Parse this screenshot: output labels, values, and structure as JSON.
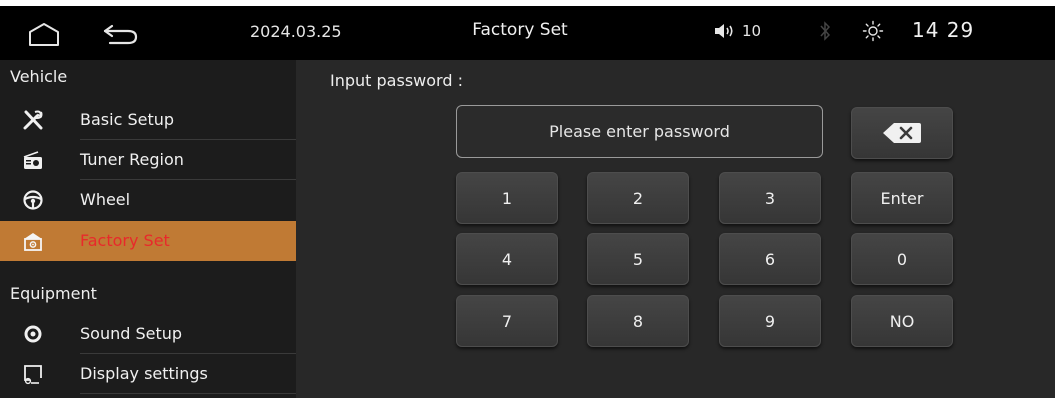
{
  "status_bar": {
    "date": "2024.03.25",
    "title": "Factory Set",
    "volume": "10",
    "time": "14 29"
  },
  "sidebar": {
    "sections": [
      {
        "heading": "Vehicle",
        "items": [
          {
            "label": "Basic Setup",
            "icon": "wrench-screwdriver-icon"
          },
          {
            "label": "Tuner Region",
            "icon": "radio-icon"
          },
          {
            "label": "Wheel",
            "icon": "steering-wheel-icon"
          },
          {
            "label": "Factory Set",
            "icon": "factory-icon",
            "active": true
          }
        ]
      },
      {
        "heading": "Equipment",
        "items": [
          {
            "label": "Sound Setup",
            "icon": "speaker-icon"
          },
          {
            "label": "Display settings",
            "icon": "display-icon"
          }
        ]
      }
    ]
  },
  "main": {
    "prompt": "Input password :",
    "password_placeholder": "Please enter password",
    "keys": {
      "k1": "1",
      "k2": "2",
      "k3": "3",
      "enter": "Enter",
      "k4": "4",
      "k5": "5",
      "k6": "6",
      "k0": "0",
      "k7": "7",
      "k8": "8",
      "k9": "9",
      "no": "NO"
    }
  },
  "colors": {
    "active_bg": "#c07a34",
    "active_text": "#e8292b",
    "panel_bg": "#282828",
    "sidebar_bg": "#1c1c1c"
  }
}
